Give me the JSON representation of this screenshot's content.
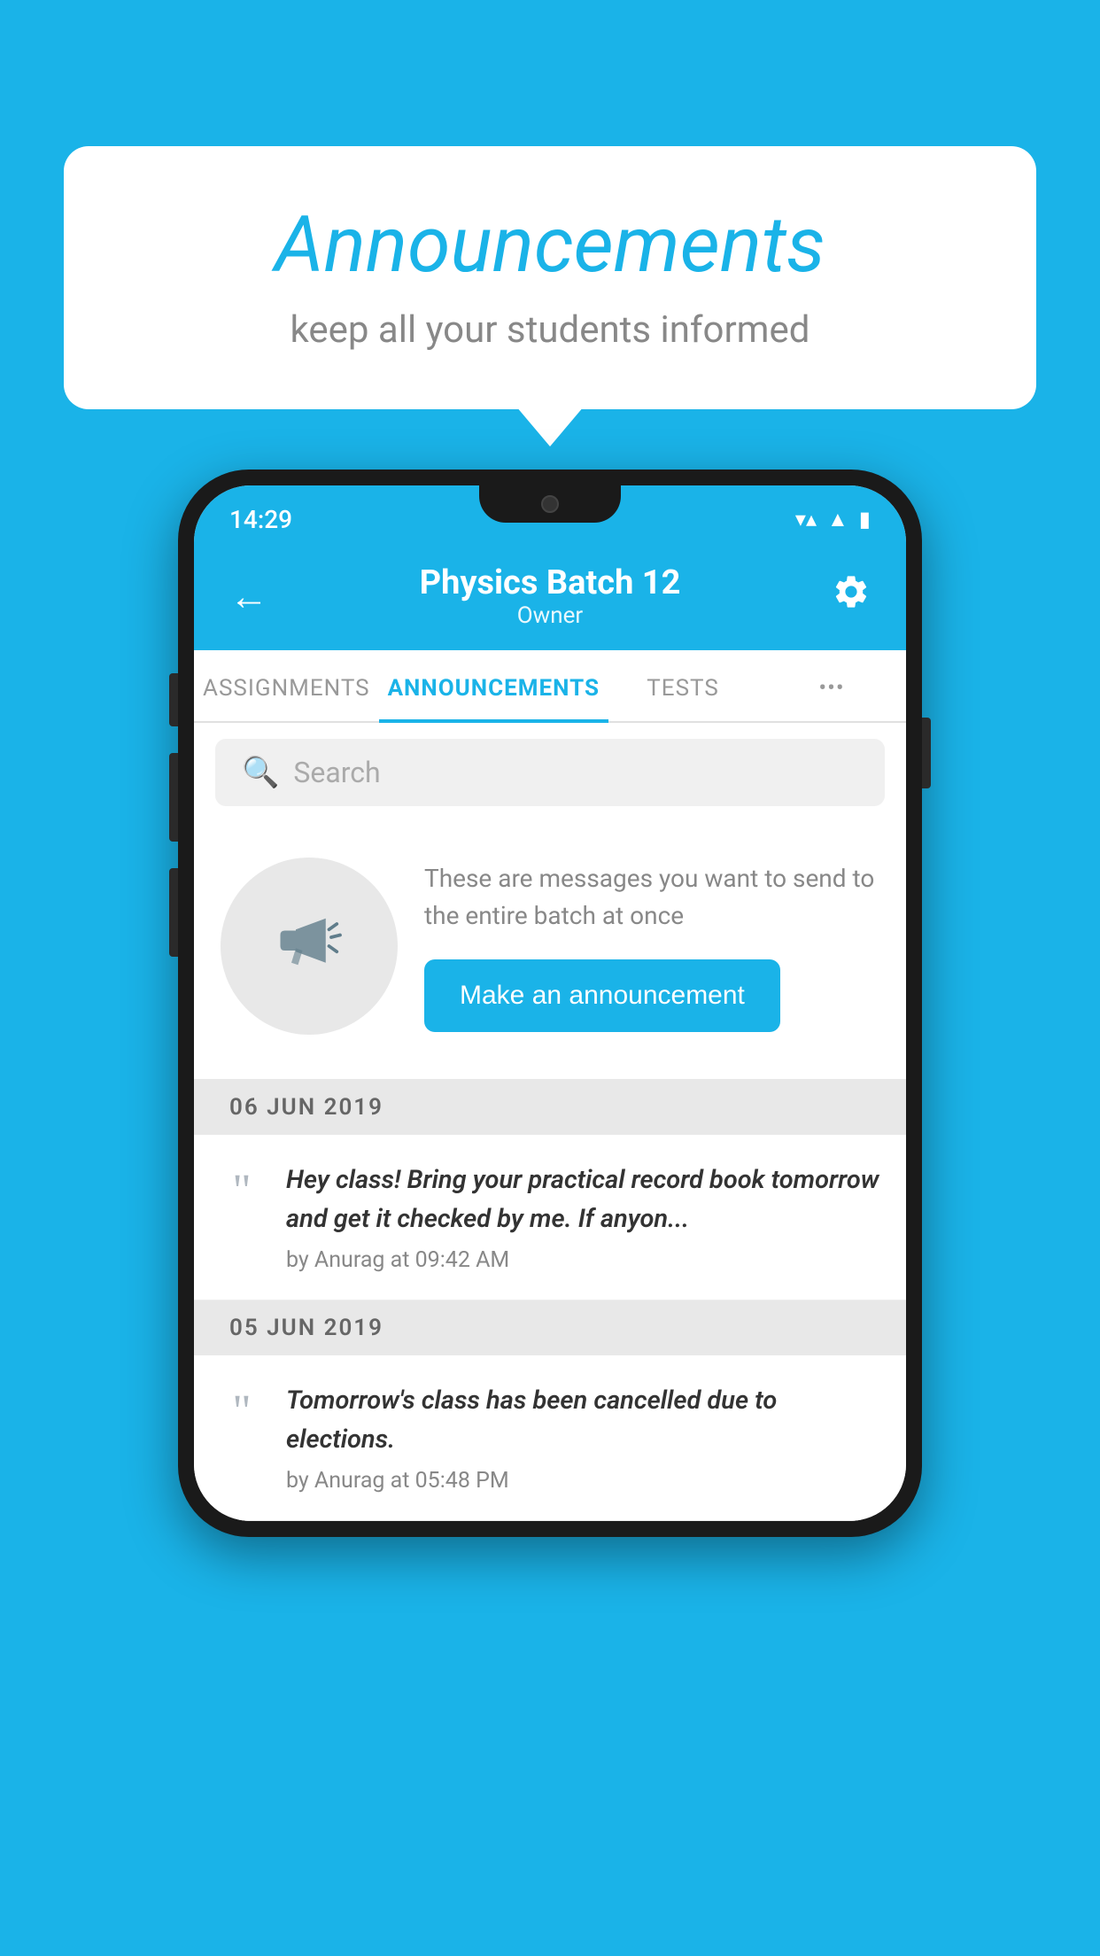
{
  "page": {
    "background_color": "#1ab3e8"
  },
  "speech_bubble": {
    "title": "Announcements",
    "subtitle": "keep all your students informed"
  },
  "status_bar": {
    "time": "14:29",
    "wifi": "▼",
    "signal": "▲",
    "battery": "▮"
  },
  "app_bar": {
    "title": "Physics Batch 12",
    "subtitle": "Owner",
    "back_label": "←",
    "settings_label": "⚙"
  },
  "tabs": [
    {
      "label": "ASSIGNMENTS",
      "active": false
    },
    {
      "label": "ANNOUNCEMENTS",
      "active": true
    },
    {
      "label": "TESTS",
      "active": false
    },
    {
      "label": "•••",
      "active": false
    }
  ],
  "search": {
    "placeholder": "Search"
  },
  "announcement_cta": {
    "description": "These are messages you want to send to the entire batch at once",
    "button_label": "Make an announcement"
  },
  "dates": [
    {
      "date": "06  JUN  2019",
      "announcements": [
        {
          "text": "Hey class! Bring your practical record book tomorrow and get it checked by me. If anyon...",
          "meta": "by Anurag at 09:42 AM"
        }
      ]
    },
    {
      "date": "05  JUN  2019",
      "announcements": [
        {
          "text": "Tomorrow's class has been cancelled due to elections.",
          "meta": "by Anurag at 05:48 PM"
        }
      ]
    }
  ]
}
